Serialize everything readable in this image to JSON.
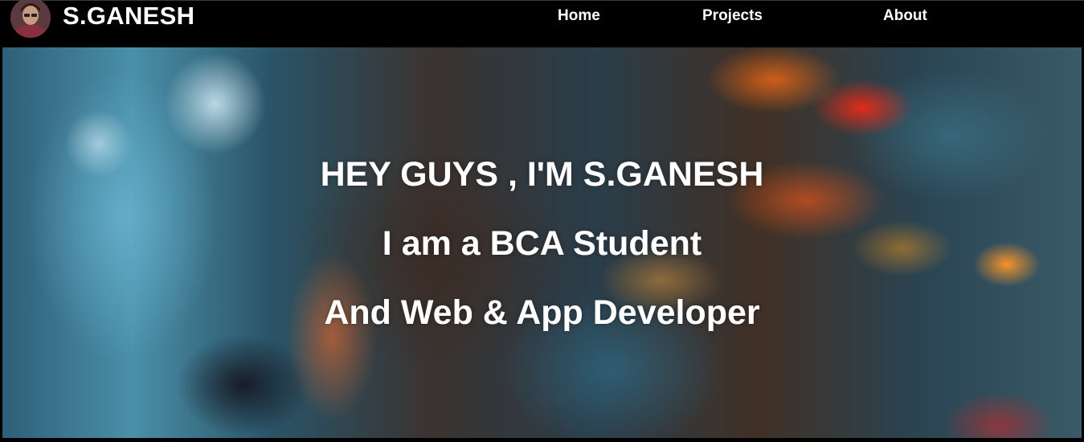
{
  "brand": {
    "name": "S.GANESH",
    "avatar": "profile-avatar"
  },
  "nav": {
    "items": [
      {
        "label": "Home"
      },
      {
        "label": "Projects"
      },
      {
        "label": "About"
      }
    ]
  },
  "hero": {
    "greeting": "HEY GUYS , I'M S.GANESH",
    "line2": "I am a BCA Student",
    "line3": "And Web & App Developer"
  },
  "colors": {
    "navbar_bg": "#000000",
    "text": "#ffffff"
  }
}
